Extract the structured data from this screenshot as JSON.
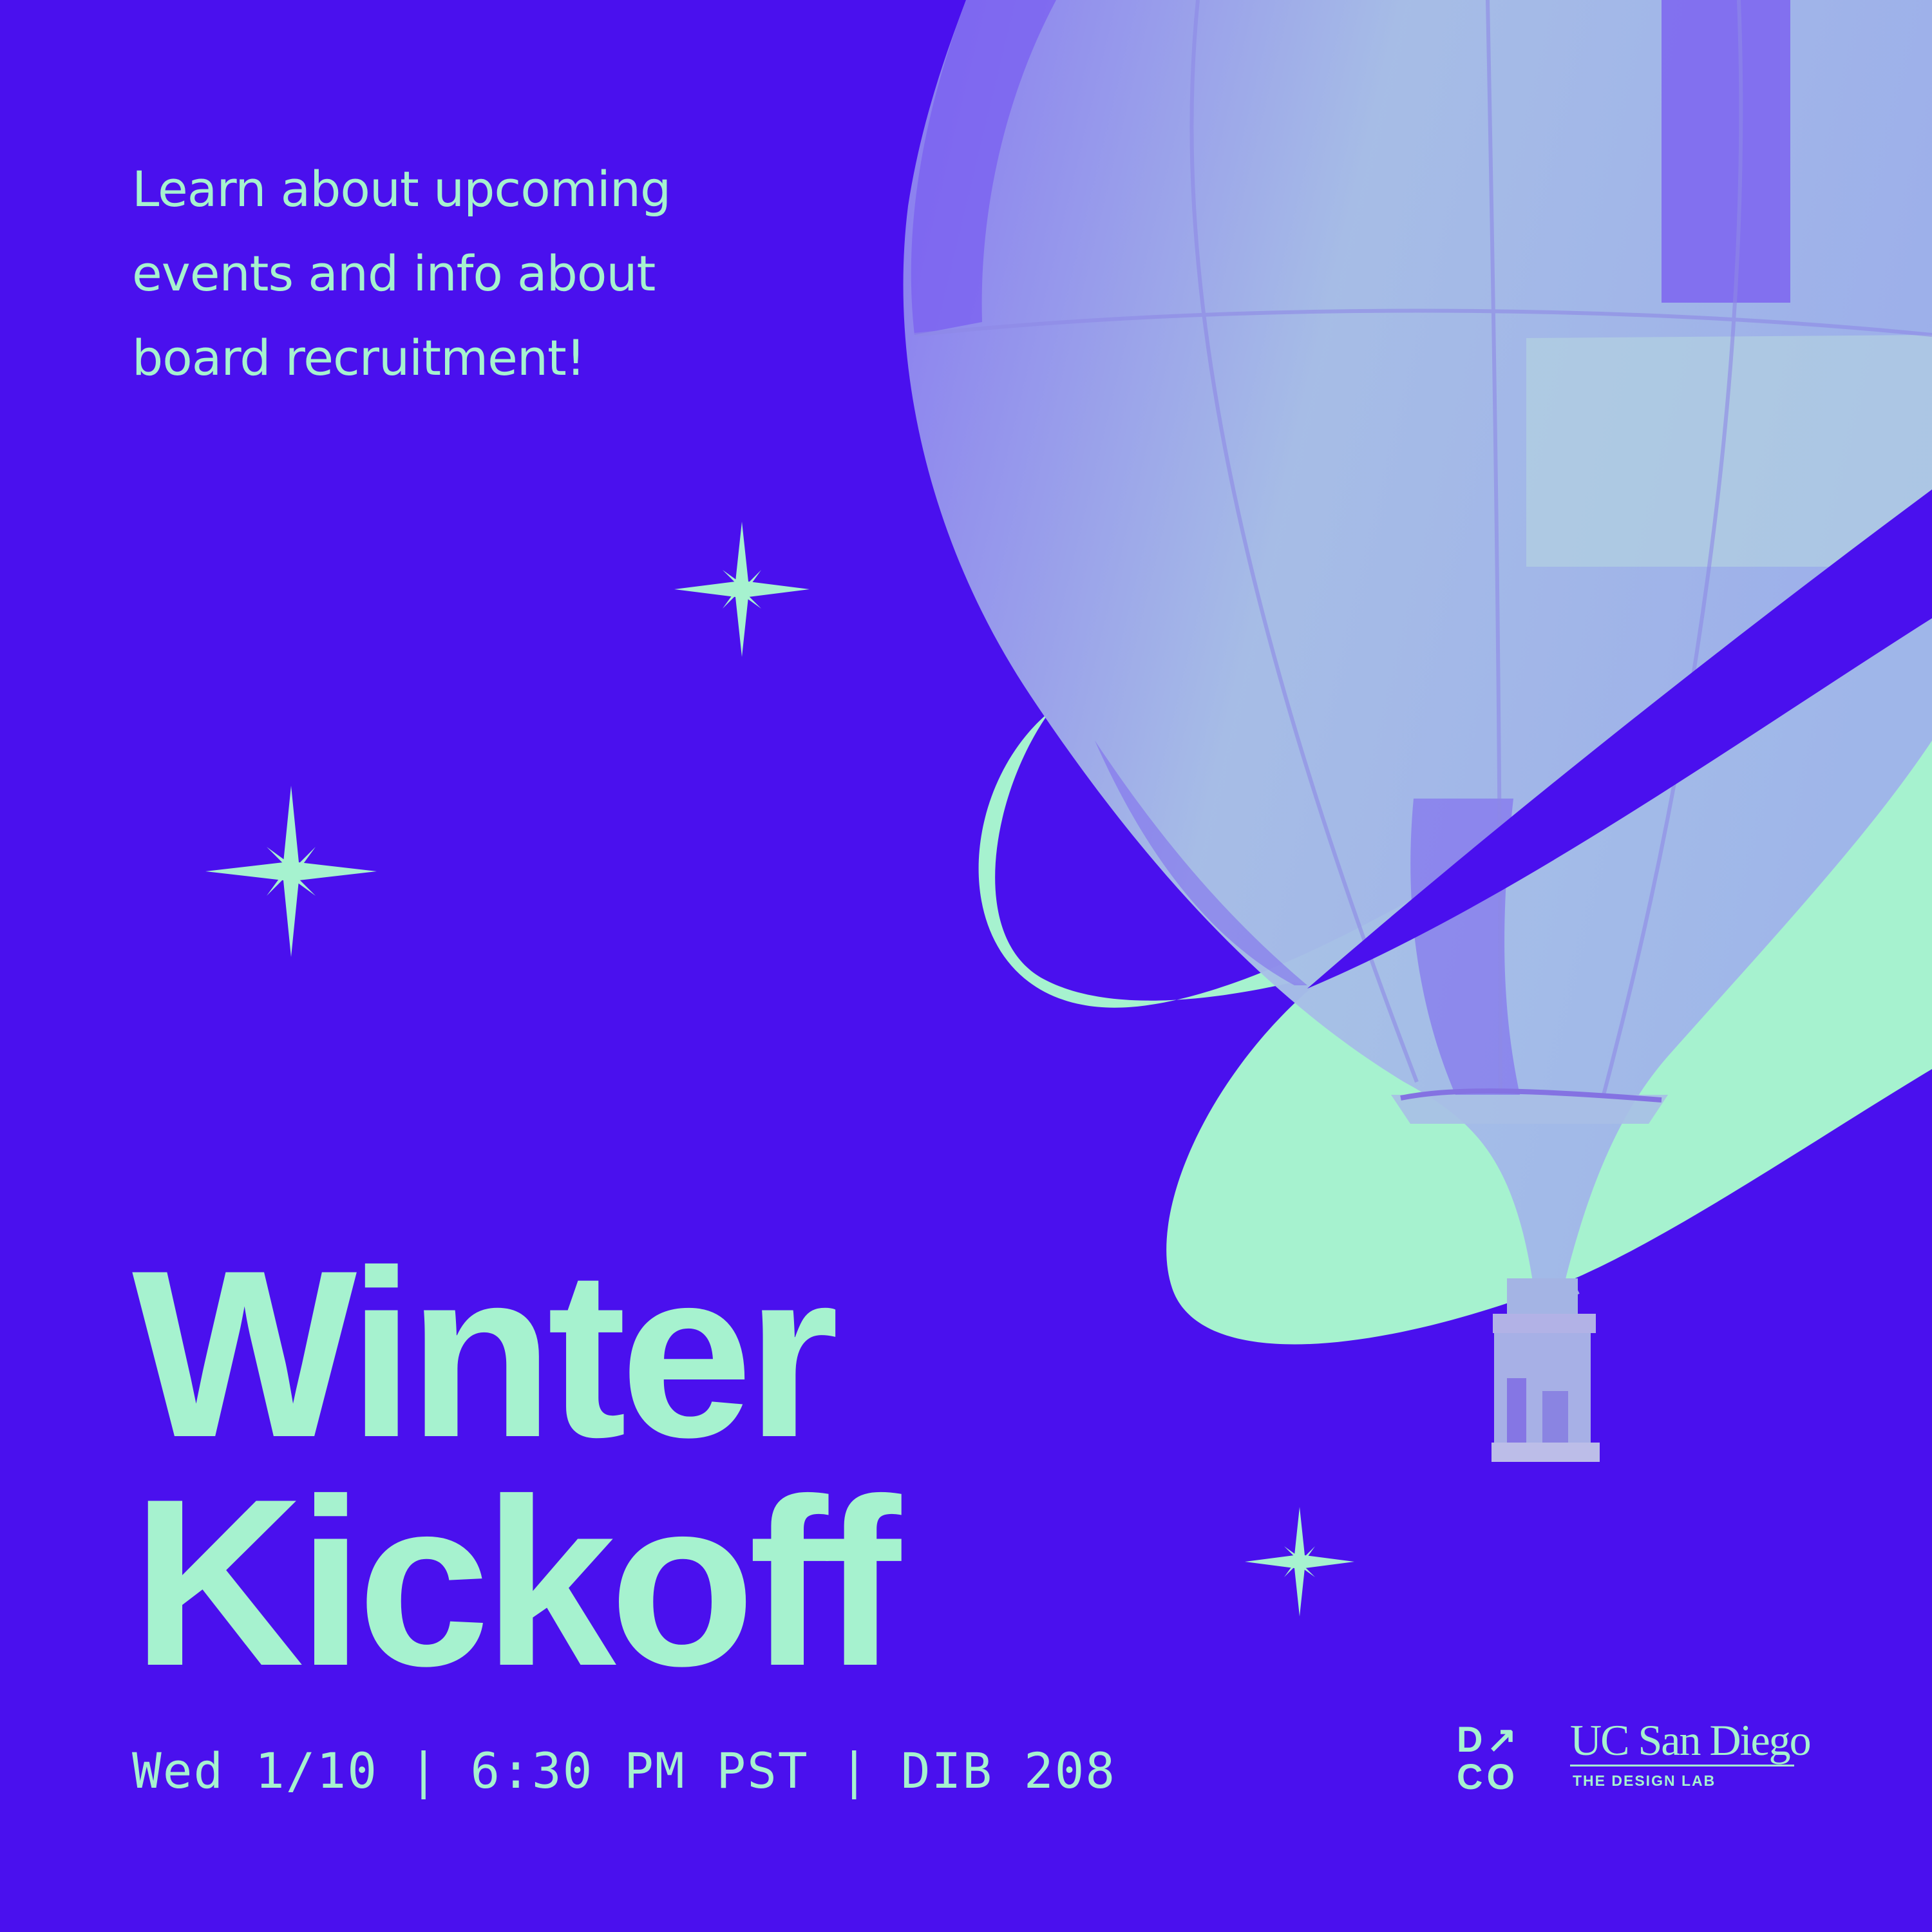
{
  "intro": {
    "lines": [
      "Learn about upcoming",
      "events and info about",
      "board recruitment!"
    ]
  },
  "title": {
    "line1": "Winter",
    "line2": "Kickoff"
  },
  "details": "Wed 1/10 | 6:30 PM PST | DIB 208",
  "logos": {
    "dco_row1": "D↗",
    "dco_row2": "CO",
    "uc": "UC San Diego",
    "uc_sub": "THE DESIGN LAB"
  },
  "colors": {
    "background": "#4a10ee",
    "accent": "#a6f2cf",
    "balloon_light": "#a4b9e6",
    "balloon_dark": "#7a5ff0"
  },
  "icons": [
    "sparkle-star-icon",
    "hot-air-balloon-illustration",
    "dco-logo",
    "uc-san-diego-logo"
  ]
}
